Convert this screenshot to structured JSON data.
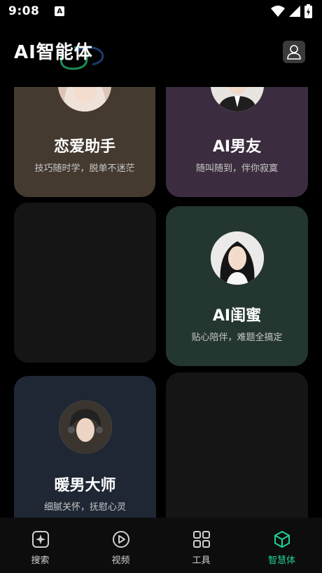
{
  "status_bar": {
    "time": "9:08",
    "notification_letter": "A"
  },
  "header": {
    "title": "AI智能体"
  },
  "cards": [
    {
      "title": "恋爱助手",
      "subtitle": "技巧随时学，脱单不迷茫",
      "bg": "#443a30"
    },
    {
      "title": "AI男友",
      "subtitle": "随叫随到，伴你寂寞",
      "bg": "#3b2d3f"
    },
    {
      "title": "AI闺蜜",
      "subtitle": "贴心陪伴，难题全搞定",
      "bg": "#243630"
    },
    {
      "title": "暖男大师",
      "subtitle": "细腻关怀，抚慰心灵",
      "bg": "#1f2735"
    }
  ],
  "nav": {
    "items": [
      {
        "label": "搜索",
        "icon": "sparkle-search-icon"
      },
      {
        "label": "视频",
        "icon": "play-circle-icon"
      },
      {
        "label": "工具",
        "icon": "grid-icon"
      },
      {
        "label": "智慧体",
        "icon": "cube-icon"
      }
    ],
    "active_color": "#21d29a"
  }
}
